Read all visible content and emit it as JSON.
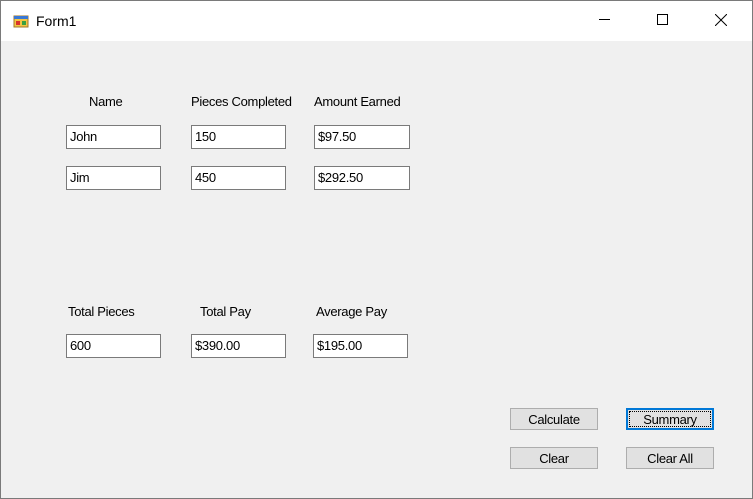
{
  "window": {
    "title": "Form1"
  },
  "titlebar_icons": [
    "app-icon",
    "minimize-icon",
    "maximize-icon",
    "close-icon"
  ],
  "labels": {
    "name": "Name",
    "pieces_completed": "Pieces Completed",
    "amount_earned": "Amount Earned",
    "total_pieces": "Total Pieces",
    "total_pay": "Total Pay",
    "average_pay": "Average Pay"
  },
  "workers": [
    {
      "name": "John",
      "pieces": "150",
      "amount": "$97.50"
    },
    {
      "name": "Jim",
      "pieces": "450",
      "amount": "$292.50"
    }
  ],
  "totals": {
    "total_pieces": "600",
    "total_pay": "$390.00",
    "average_pay": "$195.00"
  },
  "buttons": {
    "calculate": "Calculate",
    "summary": "Summary",
    "clear": "Clear",
    "clear_all": "Clear All"
  }
}
